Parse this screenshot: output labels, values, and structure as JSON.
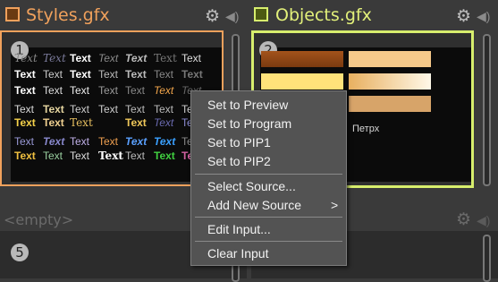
{
  "panels": [
    {
      "slot": "1",
      "title": "Styles.gfx",
      "title_color": "#f0a15c",
      "border": "#f0a15c"
    },
    {
      "slot": "2",
      "title": "Objects.gfx",
      "title_color": "#e2f07a",
      "border": "#d7ee6d"
    },
    {
      "slot": "5",
      "title": "<empty>"
    }
  ],
  "style_samples": [
    [
      "Text",
      "Text",
      "Text",
      "Text",
      "Text",
      "Text",
      "Text"
    ],
    [
      "Text",
      "Text",
      "Text",
      "Text",
      "Text",
      "Text",
      "Text"
    ],
    [
      "Text",
      "Text",
      "Text",
      "Text",
      "Text",
      "Text",
      "Text"
    ],
    [
      "Text",
      "Text",
      "Text",
      "Text",
      "Text",
      "Text",
      "Text"
    ],
    [
      "Text",
      "Text",
      "Text",
      "Text",
      "Text",
      "Text",
      "Text"
    ],
    [
      "Text",
      "Text",
      "Text",
      "Text",
      "Text",
      "Text",
      "Text"
    ],
    [
      "Text",
      "Text",
      "Text",
      "Text",
      "Text",
      "Text",
      "Text"
    ]
  ],
  "objects_caption": "Петрх",
  "menu": {
    "items": [
      {
        "label": "Set to Preview"
      },
      {
        "label": "Set to Program"
      },
      {
        "label": "Set to PIP1"
      },
      {
        "label": "Set to PIP2"
      },
      {
        "label": "Select Source..."
      },
      {
        "label": "Add New Source",
        "submenu": ">"
      },
      {
        "label": "Edit Input..."
      },
      {
        "label": "Clear Input"
      }
    ]
  },
  "icons": {
    "gear": "gear-icon",
    "speaker": "speaker-icon",
    "file": "gfx-file-icon"
  }
}
